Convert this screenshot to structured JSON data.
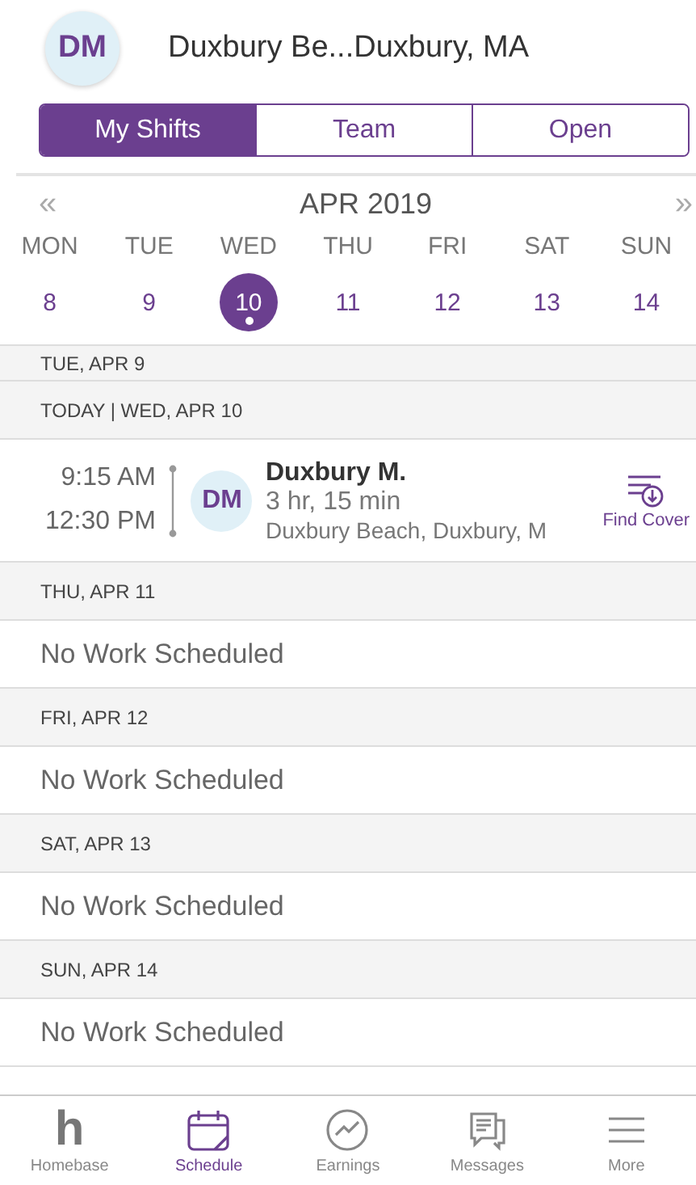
{
  "header": {
    "initials": "DM",
    "title": "Duxbury Be...Duxbury, MA"
  },
  "tabs": [
    {
      "label": "My Shifts",
      "selected": true
    },
    {
      "label": "Team",
      "selected": false
    },
    {
      "label": "Open",
      "selected": false
    }
  ],
  "calendar": {
    "prev": "«",
    "month": "APR 2019",
    "next": "»",
    "days": [
      {
        "weekday": "MON",
        "date": "8",
        "selected": false,
        "has_shift": false
      },
      {
        "weekday": "TUE",
        "date": "9",
        "selected": false,
        "has_shift": false
      },
      {
        "weekday": "WED",
        "date": "10",
        "selected": true,
        "has_shift": true
      },
      {
        "weekday": "THU",
        "date": "11",
        "selected": false,
        "has_shift": false
      },
      {
        "weekday": "FRI",
        "date": "12",
        "selected": false,
        "has_shift": false
      },
      {
        "weekday": "SAT",
        "date": "13",
        "selected": false,
        "has_shift": false
      },
      {
        "weekday": "SUN",
        "date": "14",
        "selected": false,
        "has_shift": false
      }
    ]
  },
  "list": [
    {
      "kind": "partial",
      "text": "TUE, APR 9"
    },
    {
      "kind": "day",
      "text": "TODAY | WED, APR 10"
    },
    {
      "kind": "shift",
      "start": "9:15 AM",
      "end": "12:30 PM",
      "initials": "DM",
      "name": "Duxbury M.",
      "duration": "3 hr, 15 min",
      "location": "Duxbury Beach, Duxbury, M",
      "action": "Find Cover"
    },
    {
      "kind": "day",
      "text": "THU, APR 11"
    },
    {
      "kind": "empty",
      "text": "No Work Scheduled"
    },
    {
      "kind": "day",
      "text": "FRI, APR 12"
    },
    {
      "kind": "empty",
      "text": "No Work Scheduled"
    },
    {
      "kind": "day",
      "text": "SAT, APR 13"
    },
    {
      "kind": "empty",
      "text": "No Work Scheduled"
    },
    {
      "kind": "day",
      "text": "SUN, APR 14"
    },
    {
      "kind": "empty",
      "text": "No Work Scheduled"
    }
  ],
  "nav": [
    {
      "kind": "home",
      "glyph": "h",
      "label": "Homebase",
      "selected": false
    },
    {
      "kind": "calendar",
      "label": "Schedule",
      "selected": true
    },
    {
      "kind": "chart",
      "label": "Earnings",
      "selected": false
    },
    {
      "kind": "chat",
      "label": "Messages",
      "selected": false
    },
    {
      "kind": "menu",
      "label": "More",
      "selected": false
    }
  ]
}
